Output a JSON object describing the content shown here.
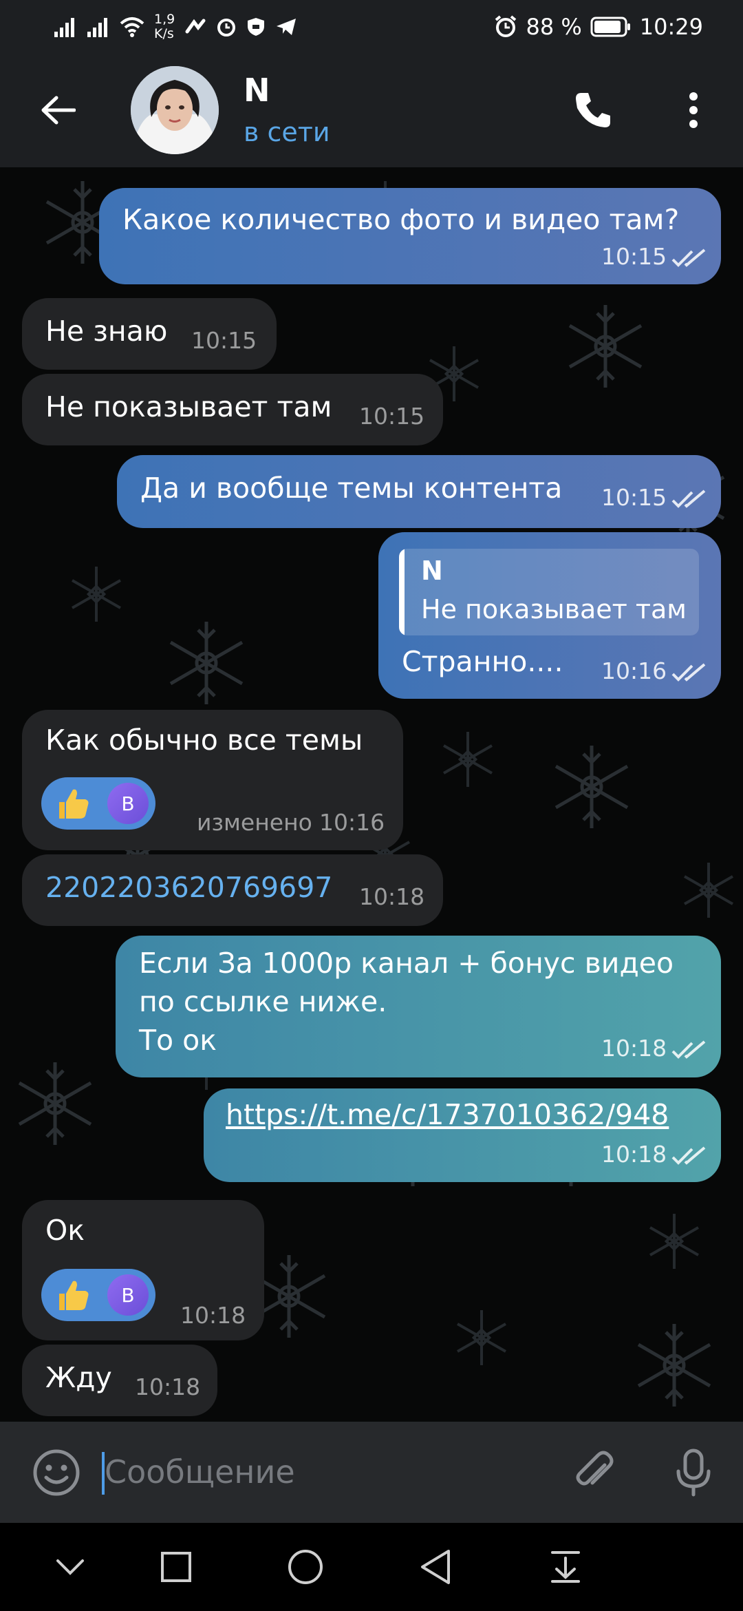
{
  "status_bar": {
    "net_speed_value": "1,9",
    "net_speed_unit": "K/s",
    "battery": "88 %",
    "time": "10:29"
  },
  "header": {
    "contact_name": "N",
    "contact_status": "в сети"
  },
  "messages": [
    {
      "direction": "out",
      "text": "Какое количество фото и видео там?",
      "time": "10:15",
      "read": true
    },
    {
      "direction": "in",
      "text": "Не знаю",
      "time": "10:15"
    },
    {
      "direction": "in",
      "text": "Не показывает там",
      "time": "10:15"
    },
    {
      "direction": "out",
      "text": "Да и  вообще темы контента",
      "time": "10:15",
      "read": true
    },
    {
      "direction": "out",
      "reply_to": {
        "name": "N",
        "text": "Не показывает там"
      },
      "text": "Странно....",
      "time": "10:16",
      "read": true
    },
    {
      "direction": "in",
      "text": "Как обычно все темы",
      "time": "10:16",
      "edited_label": "изменено",
      "reaction": {
        "emoji": "thumbs-up",
        "avatar_letter": "B"
      }
    },
    {
      "direction": "in",
      "text": "2202203620769697",
      "time": "10:18",
      "is_number_link": true
    },
    {
      "direction": "out",
      "lines": [
        "Если За 1000р канал + бонус видео",
        "по ссылке ниже.",
        "То ок"
      ],
      "time": "10:18",
      "read": true
    },
    {
      "direction": "out",
      "text": "https://t.me/c/1737010362/948",
      "time": "10:18",
      "read": true,
      "is_url": true
    },
    {
      "direction": "in",
      "text": "Ок",
      "time": "10:18",
      "reaction": {
        "emoji": "thumbs-up",
        "avatar_letter": "B"
      }
    },
    {
      "direction": "in",
      "text": "Жду",
      "time": "10:18"
    }
  ],
  "input": {
    "placeholder": "Сообщение",
    "value": ""
  },
  "colors": {
    "accent": "#5aa6e6",
    "bar_background": "#1d1f22",
    "incoming_bubble": "#232426",
    "outgoing_bubble_blue": "#4a75b5",
    "outgoing_bubble_teal": "#4a98a8"
  }
}
